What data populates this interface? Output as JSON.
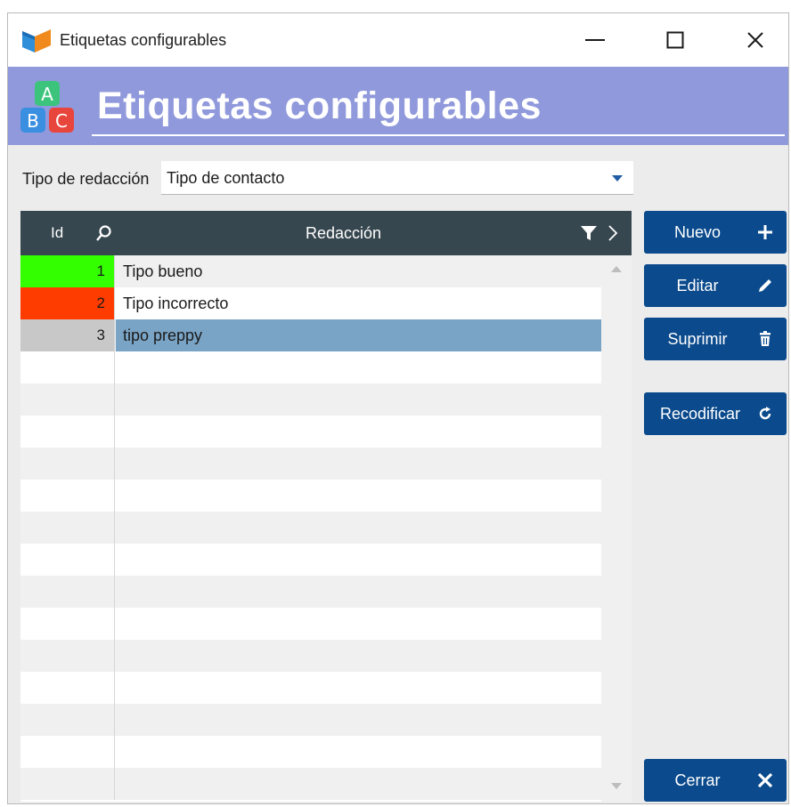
{
  "window": {
    "title": "Etiquetas configurables",
    "controls": [
      "minimize-icon",
      "maximize-icon",
      "close-icon"
    ]
  },
  "header": {
    "title": "Etiquetas configurables",
    "icon": "abc-blocks-icon",
    "background": "#9099db"
  },
  "tipo": {
    "label": "Tipo de redacción",
    "value": "Tipo de contacto"
  },
  "grid": {
    "columns": {
      "id": "Id",
      "redaccion": "Redacción"
    },
    "rows": [
      {
        "id": "1",
        "text": "Tipo bueno",
        "color": "#33ff00"
      },
      {
        "id": "2",
        "text": "Tipo incorrecto",
        "color": "#ff3c00"
      },
      {
        "id": "3",
        "text": "tipo preppy",
        "color": "#c8c8c8",
        "selected": true
      }
    ],
    "selection_color": "#7aa4c5",
    "header_color": "#37474f"
  },
  "buttons": {
    "nuevo": "Nuevo",
    "editar": "Editar",
    "suprimir": "Suprimir",
    "recodificar": "Recodificar",
    "cerrar": "Cerrar",
    "color": "#0b4a8c"
  }
}
